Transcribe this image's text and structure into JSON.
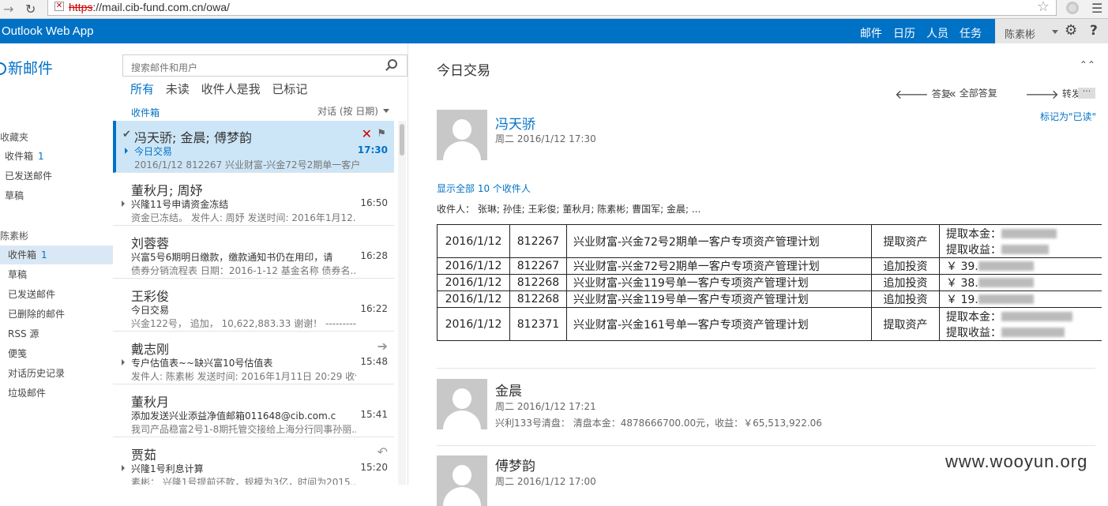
{
  "browser": {
    "url_protocol": "https",
    "url_rest": "://mail.cib-fund.com.cn/owa/"
  },
  "header": {
    "brand": "Outlook Web App",
    "nav": [
      "邮件",
      "日历",
      "人员",
      "任务"
    ],
    "user": "陈素彬"
  },
  "folders": {
    "new_mail": "新邮件",
    "favorites_title": "收藏夹",
    "favorites": [
      {
        "label": "收件箱",
        "count": "1"
      },
      {
        "label": "已发送邮件",
        "count": ""
      },
      {
        "label": "草稿",
        "count": ""
      }
    ],
    "account_title": "陈素彬",
    "account_folders": [
      {
        "label": "收件箱",
        "count": "1"
      },
      {
        "label": "草稿",
        "count": ""
      },
      {
        "label": "已发送邮件",
        "count": ""
      },
      {
        "label": "已删除的邮件",
        "count": ""
      },
      {
        "label": "RSS 源",
        "count": ""
      },
      {
        "label": "便笺",
        "count": ""
      },
      {
        "label": "对话历史记录",
        "count": ""
      },
      {
        "label": "垃圾邮件",
        "count": ""
      }
    ]
  },
  "list": {
    "search_placeholder": "搜索邮件和用户",
    "filters": [
      "所有",
      "未读",
      "收件人是我",
      "已标记"
    ],
    "folder": "收件箱",
    "sort": "对话 (按 日期)",
    "messages": [
      {
        "sender": "冯天骄; 金晨; 傅梦韵",
        "subject": "今日交易",
        "preview": "2016/1/12   812267   兴业财富-兴金72号2期单一客户...",
        "time": "17:30"
      },
      {
        "sender": "董秋月; 周妤",
        "subject": "兴隆11号申请资金冻结",
        "preview": "资金已冻结。   发件人: 周妤 发送时间: 2016年1月12...",
        "time": "16:50"
      },
      {
        "sender": "刘蓉蓉",
        "subject": "兴富5号6期明日缴款，缴款通知书仍在用印，请",
        "preview": "债券分销流程表 日期：2016-1-12 基金名称  债券名...",
        "time": "16:28"
      },
      {
        "sender": "王彩俊",
        "subject": "今日交易",
        "preview": "兴金122号，  追加，  10,622,883.33    谢谢！ ---------...",
        "time": "16:22"
      },
      {
        "sender": "戴志刚",
        "subject": "专户估值表~~缺兴富10号估值表",
        "preview": "发件人: 陈素彬 发送时间: 2016年1月11日 20:29 收件...",
        "time": "15:48"
      },
      {
        "sender": "董秋月",
        "subject": "添加发送兴业添益净值邮箱011648@cib.com.cr",
        "preview": "我司产品稳富2号1-8期托管交接给上海分行同事孙丽...",
        "time": "15:41"
      },
      {
        "sender": "贾茹",
        "subject": "兴隆1号利息计算",
        "preview": "素彬：  兴隆1号提前还款，规模为3亿，时间为2015...",
        "time": "15:20"
      }
    ]
  },
  "reading": {
    "title": "今日交易",
    "actions": {
      "reply": "答复",
      "reply_all": "全部答复",
      "forward": "转发"
    },
    "mark_read": "标记为\"已读\"",
    "more": "···",
    "first": {
      "sender": "冯天骄",
      "date": "周二 2016/1/12 17:30",
      "show_recipients": "显示全部 10 个收件人",
      "recipients": "收件人：  张琳;   孙佳;   王彩俊;   董秋月;   陈素彬;   曹国军;   金晨;   ..."
    },
    "table": [
      {
        "date": "2016/1/12",
        "code": "812267",
        "name": "兴业财富-兴金72号2期单一客户专项资产管理计划",
        "type": "提取资产",
        "detail": [
          "提取本金：",
          "提取收益："
        ],
        "tall": true
      },
      {
        "date": "2016/1/12",
        "code": "812267",
        "name": "兴业财富-兴金72号2期单一客户专项资产管理计划",
        "type": "追加投资",
        "detail": [
          "￥       39."
        ],
        "tall": false
      },
      {
        "date": "2016/1/12",
        "code": "812268",
        "name": "兴业财富-兴金119号单一客户专项资产管理计划",
        "type": "追加投资",
        "detail": [
          "￥       38."
        ],
        "tall": false
      },
      {
        "date": "2016/1/12",
        "code": "812268",
        "name": "兴业财富-兴金119号单一客户专项资产管理计划",
        "type": "追加投资",
        "detail": [
          "￥       19."
        ],
        "tall": false
      },
      {
        "date": "2016/1/12",
        "code": "812371",
        "name": "兴业财富-兴金161号单一客户专项资产管理计划",
        "type": "提取资产",
        "detail": [
          "提取本金：",
          "提取收益："
        ],
        "tall": true
      }
    ],
    "second": {
      "sender": "金晨",
      "date": "周二 2016/1/12 17:21",
      "preview": "兴利133号清盘：  清盘本金：4878666700.00元，收益：￥65,513,922.06"
    },
    "third": {
      "sender": "傅梦韵",
      "date": "周二 2016/1/12 17:00"
    }
  },
  "watermark": "www.wooyun.org"
}
